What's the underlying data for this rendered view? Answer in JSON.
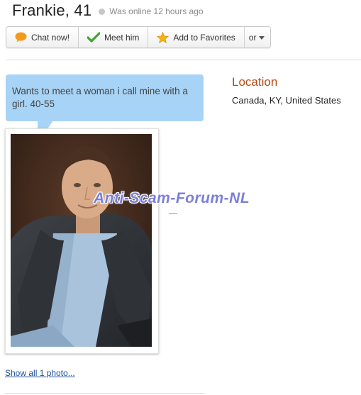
{
  "profile": {
    "name_age": "Frankie, 41",
    "status_text": "Was online 12 hours ago"
  },
  "toolbar": {
    "chat_label": "Chat now!",
    "meet_label": "Meet him",
    "favorites_label": "Add to Favorites",
    "or_label": "or"
  },
  "bubble": {
    "text": "Wants to meet a woman i call mine with a girl. 40-55"
  },
  "location": {
    "title": "Location",
    "value": "Canada, KY, United States"
  },
  "watermark": "Anti-Scam-Forum-NL",
  "photos": {
    "show_all": "Show all 1 photo..."
  },
  "colors": {
    "bubble": "#a7d3f6",
    "location_title": "#b94a14",
    "link": "#1a4f9c",
    "watermark": "#7b7fd8"
  },
  "icons": {
    "chat": "speech-bubble-icon",
    "meet": "checkmark-icon",
    "favorites": "star-icon",
    "status": "status-dot-icon",
    "more": "caret-down-icon"
  }
}
